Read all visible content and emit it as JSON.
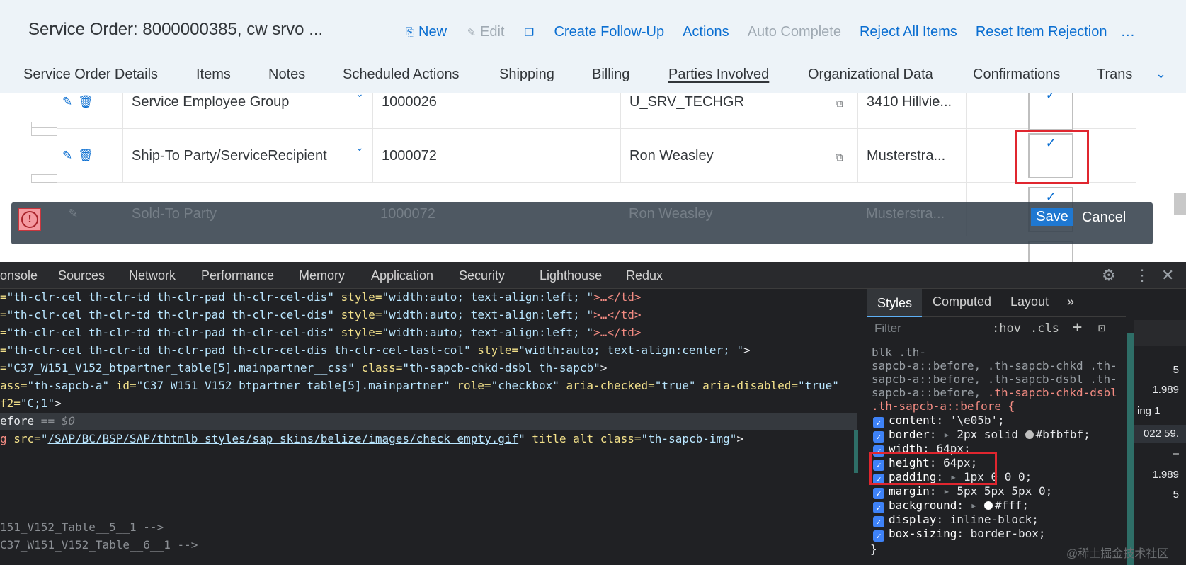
{
  "header": {
    "title": "Service Order: 8000000385, cw srvo ...",
    "toolbar": {
      "new": "New",
      "edit": "Edit",
      "create_follow_up": "Create Follow-Up",
      "actions": "Actions",
      "auto_complete": "Auto Complete",
      "reject_all_items": "Reject All Items",
      "reset_item_rejection": "Reset Item Rejection",
      "more": "..."
    },
    "tabs": [
      "Service Order Details",
      "Items",
      "Notes",
      "Scheduled Actions",
      "Shipping",
      "Billing",
      "Parties Involved",
      "Organizational Data",
      "Confirmations",
      "Trans"
    ],
    "active_tab": "Parties Involved"
  },
  "table": {
    "rows": [
      {
        "function": "Service Employee Group",
        "id": "1000026",
        "name": "U_SRV_TECHGR",
        "address": "3410 Hillvie...",
        "main_partner": true
      },
      {
        "function": "Ship-To Party/ServiceRecipient",
        "id": "1000072",
        "name": "Ron Weasley",
        "address": "Musterstra...",
        "main_partner": true
      },
      {
        "function": "Sold-To Party",
        "id": "1000072",
        "name": "Ron Weasley",
        "address": "Musterstra...",
        "main_partner": true
      }
    ]
  },
  "message_bar": {
    "save": "Save",
    "cancel": "Cancel",
    "error_glyph": "!"
  },
  "devtools": {
    "tabs": [
      "onsole",
      "Sources",
      "Network",
      "Performance",
      "Memory",
      "Application",
      "Security",
      "Lighthouse",
      "Redux"
    ],
    "code_lines": [
      {
        "attr": "=",
        "val": "\"th-clr-cel th-clr-td th-clr-pad th-clr-cel-dis\"",
        "attr2": " style=",
        "val2": "\"width:auto; text-align:left; \"",
        "tail": ">…</td>"
      },
      {
        "attr": "=",
        "val": "\"th-clr-cel th-clr-td th-clr-pad th-clr-cel-dis\"",
        "attr2": " style=",
        "val2": "\"width:auto; text-align:left; \"",
        "tail": ">…</td>"
      },
      {
        "attr": "=",
        "val": "\"th-clr-cel th-clr-td th-clr-pad th-clr-cel-dis\"",
        "attr2": " style=",
        "val2": "\"width:auto; text-align:left; \"",
        "tail": ">…</td>"
      },
      {
        "attr": "=",
        "val": "\"th-clr-cel th-clr-td th-clr-pad th-clr-cel-dis th-clr-cel-last-col\"",
        "attr2": " style=",
        "val2": "\"width:auto; text-align:center; \"",
        "tail": ">"
      },
      {
        "attr": "=",
        "val": "\"C37_W151_V152_btpartner_table[5].mainpartner__css\"",
        "attr2": " class=",
        "val2": "\"th-sapcb-chkd-dsbl th-sapcb\"",
        "tail": ">"
      },
      {
        "attr": "ass=",
        "val": "\"th-sapcb-a\"",
        "attr2": " id=",
        "val2": "\"C37_W151_V152_btpartner_table[5].mainpartner\"",
        "attr3": " role=",
        "val3": "\"checkbox\"",
        "attr4": " aria-checked=",
        "val4": "\"true\"",
        "attr5": " aria-disabled=",
        "val5": "\"true\""
      },
      {
        "attr": "f2=",
        "val": "\"C;1\"",
        "tail": ">"
      }
    ],
    "selected_line": {
      "text": "efore",
      "suffix": " == $0"
    },
    "img_line": {
      "tag": "g",
      "attr": " src=",
      "link": "/SAP/BC/BSP/SAP/thtmlb_styles/sap_skins/belize/images/check_empty.gif",
      "rest_attr": " title alt class=",
      "rest_val": "\"th-sapcb-img\"",
      "tail": ">"
    },
    "comment_1": "151_V152_Table__5__1 -->",
    "comment_2": "C37_W151_V152_Table__6__1 -->",
    "styles": {
      "tabs": [
        "Styles",
        "Computed",
        "Layout",
        "»"
      ],
      "filter_placeholder": "Filter",
      "hov": ":hov",
      "cls": ".cls",
      "plus": "+",
      "selector_lines": [
        "blk .th-",
        "sapcb-a::before, .th-sapcb-chkd .th-",
        "sapcb-a::before, .th-sapcb-dsbl .th-",
        "sapcb-a::before, "
      ],
      "selector_hot": ".th-sapcb-chkd-dsbl",
      "selector_main": ".th-sapcb-a::before {",
      "declarations": [
        {
          "prop": "content",
          "val": "'\\e05b';"
        },
        {
          "prop": "border",
          "val": "2px solid ",
          "color_name": "#bfbfbf;",
          "swatch": "#bfbfbf",
          "expand": true
        },
        {
          "prop": "width",
          "val": "64px;"
        },
        {
          "prop": "height",
          "val": "64px;"
        },
        {
          "prop": "padding",
          "val": "1px 0 0 0;",
          "expand": true
        },
        {
          "prop": "margin",
          "val": "5px 5px 5px 0;",
          "expand": true
        },
        {
          "prop": "background",
          "val": "",
          "color_name": "#fff;",
          "swatch": "#ffffff",
          "expand": true
        },
        {
          "prop": "display",
          "val": "inline-block;"
        },
        {
          "prop": "box-sizing",
          "val": "border-box;"
        }
      ],
      "closing": "}"
    },
    "computed": [
      "5",
      "1.989",
      "ing  1",
      "022  59.",
      "–",
      "1.989",
      "5"
    ]
  },
  "watermark": "@稀土掘金技术社区",
  "colors": {
    "sap_blue": "#0a6ed1",
    "highlight_red": "#e0262f",
    "devtools_bg": "#202124"
  }
}
